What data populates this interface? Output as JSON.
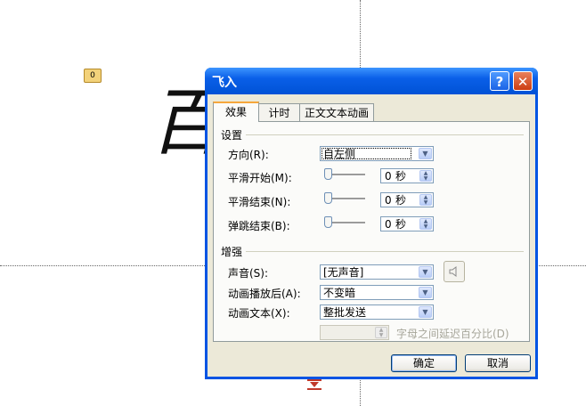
{
  "background": {
    "anim_tag": "0",
    "slide_glyph": "百"
  },
  "dialog": {
    "title": "飞入",
    "help_label": "?",
    "close_label": "✕",
    "tabs": [
      {
        "label": "效果",
        "active": true
      },
      {
        "label": "计时",
        "active": false
      },
      {
        "label": "正文文本动画",
        "active": false
      }
    ],
    "settings": {
      "group_label": "设置",
      "direction_label": "方向(R):",
      "direction_value": "自左侧",
      "smooth_start_label": "平滑开始(M):",
      "smooth_start_value": "0",
      "smooth_end_label": "平滑结束(N):",
      "smooth_end_value": "0",
      "bounce_end_label": "弹跳结束(B):",
      "bounce_end_value": "0",
      "unit_seconds": "秒"
    },
    "enhance": {
      "group_label": "增强",
      "sound_label": "声音(S):",
      "sound_value": "[无声音]",
      "after_label": "动画播放后(A):",
      "after_value": "不变暗",
      "text_anim_label": "动画文本(X):",
      "text_anim_value": "整批发送",
      "delay_label": "字母之间延迟百分比(D)",
      "delay_value": ""
    },
    "ok_label": "确定",
    "cancel_label": "取消"
  },
  "icons": {
    "sound": "speaker-icon",
    "help": "question-icon",
    "close": "close-icon"
  }
}
